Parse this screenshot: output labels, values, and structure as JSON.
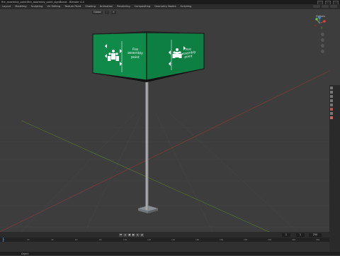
{
  "window": {
    "title": "fire_assembly_point/fire_assembly_point_signBoard - Blender 4.4"
  },
  "workspace_tabs": [
    "Layout",
    "Modeling",
    "Sculpting",
    "UV Editing",
    "Texture Paint",
    "Shading",
    "Animation",
    "Rendering",
    "Compositing",
    "Geometry Nodes",
    "Scripting"
  ],
  "viewport": {
    "mode_label": "Object",
    "transform_label": "Global",
    "options_label": "Options"
  },
  "sign": {
    "line1": "Fire",
    "line2": "assembly",
    "line3": "point",
    "color": "#0f8a48"
  },
  "timeline": {
    "current_frame": "1",
    "start_frame": "1",
    "end_frame": "250",
    "ticks": [
      "0",
      "20",
      "40",
      "60",
      "80",
      "100",
      "120",
      "140",
      "160",
      "180",
      "200",
      "220",
      "240",
      "260"
    ]
  },
  "statusbar": {
    "text": "Object"
  }
}
